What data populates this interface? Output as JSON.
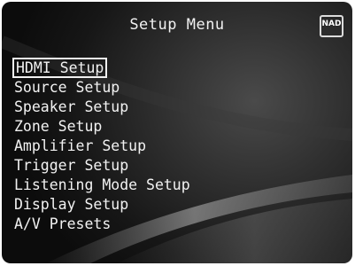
{
  "header": {
    "title": "Setup Menu",
    "logo_text": "NAD"
  },
  "menu": {
    "selected_index": 0,
    "items": [
      {
        "label": "HDMI Setup"
      },
      {
        "label": "Source Setup"
      },
      {
        "label": "Speaker Setup"
      },
      {
        "label": "Zone Setup"
      },
      {
        "label": "Amplifier Setup"
      },
      {
        "label": "Trigger Setup"
      },
      {
        "label": "Listening Mode Setup"
      },
      {
        "label": "Display Setup"
      },
      {
        "label": "A/V Presets"
      }
    ]
  },
  "colors": {
    "background": "#1a1a1a",
    "text": "#f2f2f2",
    "highlight_border": "#f0f0f0"
  }
}
